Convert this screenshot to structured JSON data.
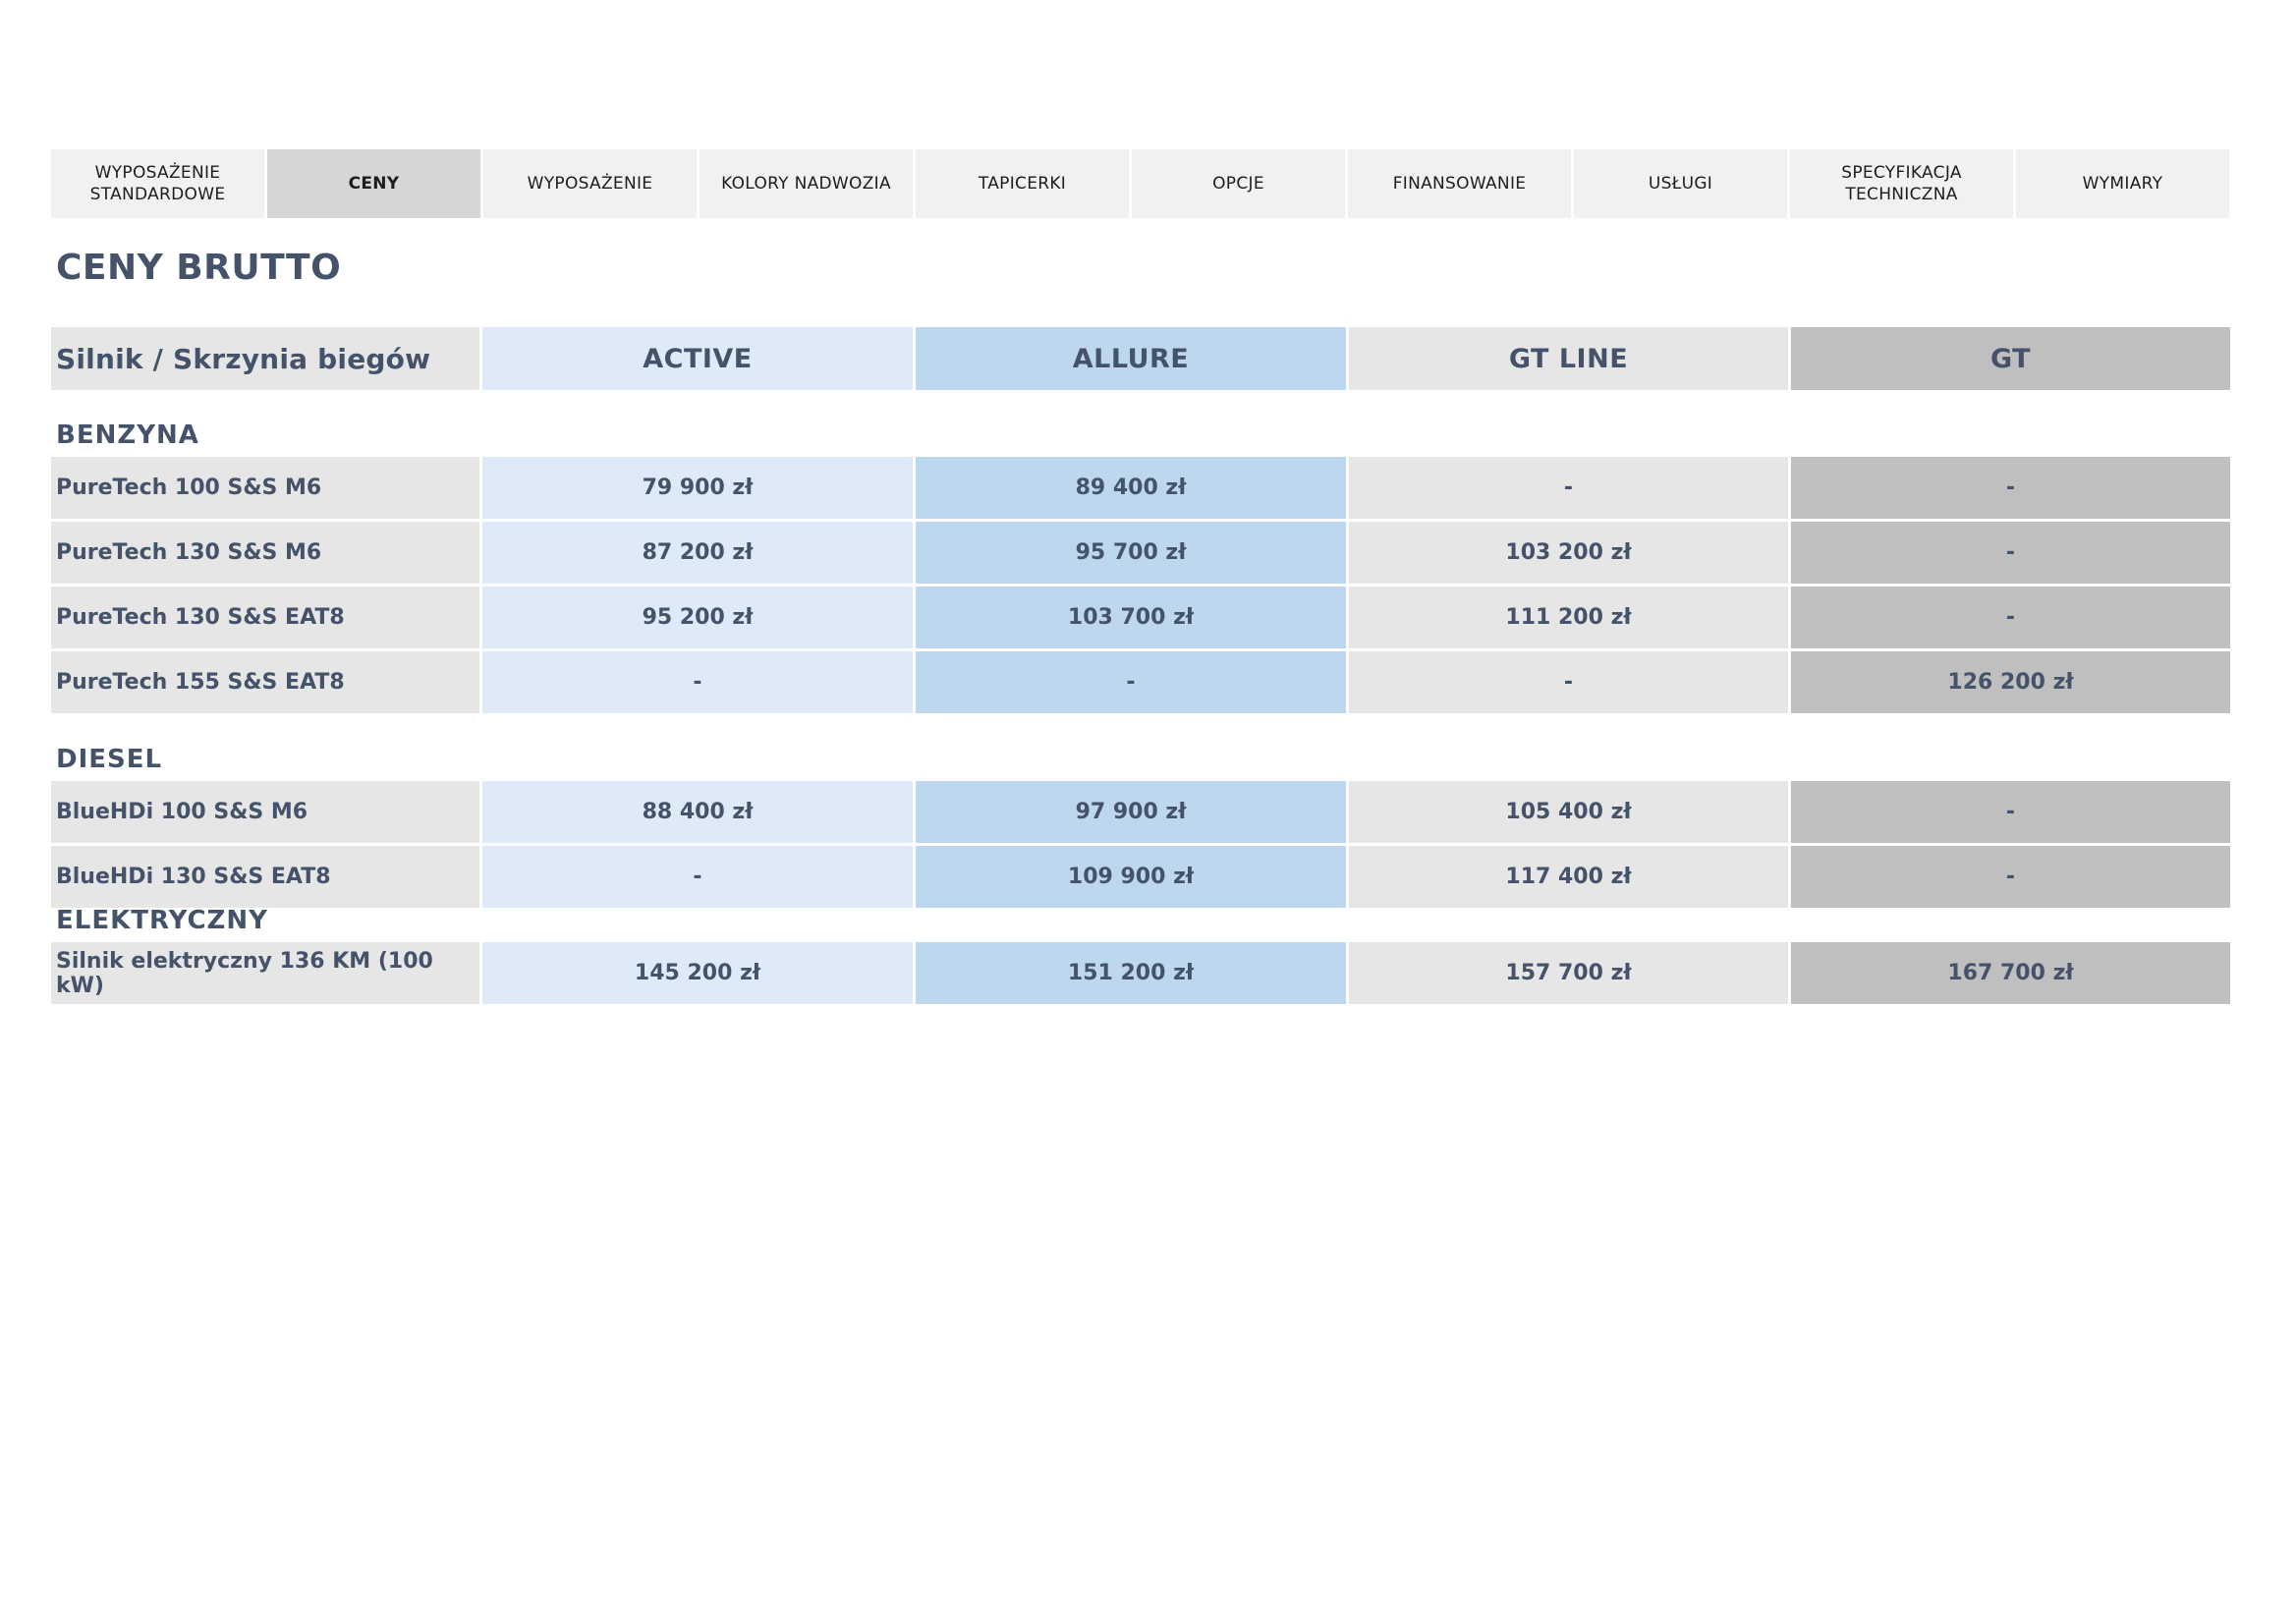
{
  "nav": {
    "tabs": [
      {
        "label": "WYPOSAŻENIE\nSTANDARDOWE",
        "active": false
      },
      {
        "label": "CENY",
        "active": true
      },
      {
        "label": "WYPOSAŻENIE",
        "active": false
      },
      {
        "label": "KOLORY NADWOZIA",
        "active": false
      },
      {
        "label": "TAPICERKI",
        "active": false
      },
      {
        "label": "OPCJE",
        "active": false
      },
      {
        "label": "FINANSOWANIE",
        "active": false
      },
      {
        "label": "USŁUGI",
        "active": false
      },
      {
        "label": "SPECYFIKACJA\nTECHNICZNA",
        "active": false
      },
      {
        "label": "WYMIARY",
        "active": false
      }
    ]
  },
  "page": {
    "title": "CENY BRUTTO"
  },
  "table": {
    "header": [
      "Silnik / Skrzynia biegów",
      "ACTIVE",
      "ALLURE",
      "GT LINE",
      "GT"
    ],
    "column_colors": [
      "#e6e6e6",
      "#deeaf8",
      "#bdd7ee",
      "#e6e6e6",
      "#bfbfbf"
    ],
    "sections": [
      {
        "title": "BENZYNA",
        "rows": [
          [
            "PureTech 100 S&S M6",
            "79 900 zł",
            "89 400 zł",
            "-",
            "-"
          ],
          [
            "PureTech 130 S&S M6",
            "87 200 zł",
            "95 700 zł",
            "103 200 zł",
            "-"
          ],
          [
            "PureTech 130 S&S EAT8",
            "95 200 zł",
            "103 700 zł",
            "111 200 zł",
            "-"
          ],
          [
            "PureTech 155 S&S EAT8",
            "-",
            "-",
            "-",
            "126 200 zł"
          ]
        ]
      },
      {
        "title": "DIESEL",
        "rows": [
          [
            "BlueHDi 100 S&S M6",
            "88 400 zł",
            "97 900 zł",
            "105 400 zł",
            "-"
          ],
          [
            "BlueHDi 130 S&S EAT8",
            "-",
            "109 900 zł",
            "117 400 zł",
            "-"
          ]
        ]
      },
      {
        "title": "ELEKTRYCZNY",
        "rows": [
          [
            "Silnik elektryczny 136 KM (100 kW)",
            "145 200 zł",
            "151 200 zł",
            "157 700 zł",
            "167 700 zł"
          ]
        ]
      }
    ]
  }
}
